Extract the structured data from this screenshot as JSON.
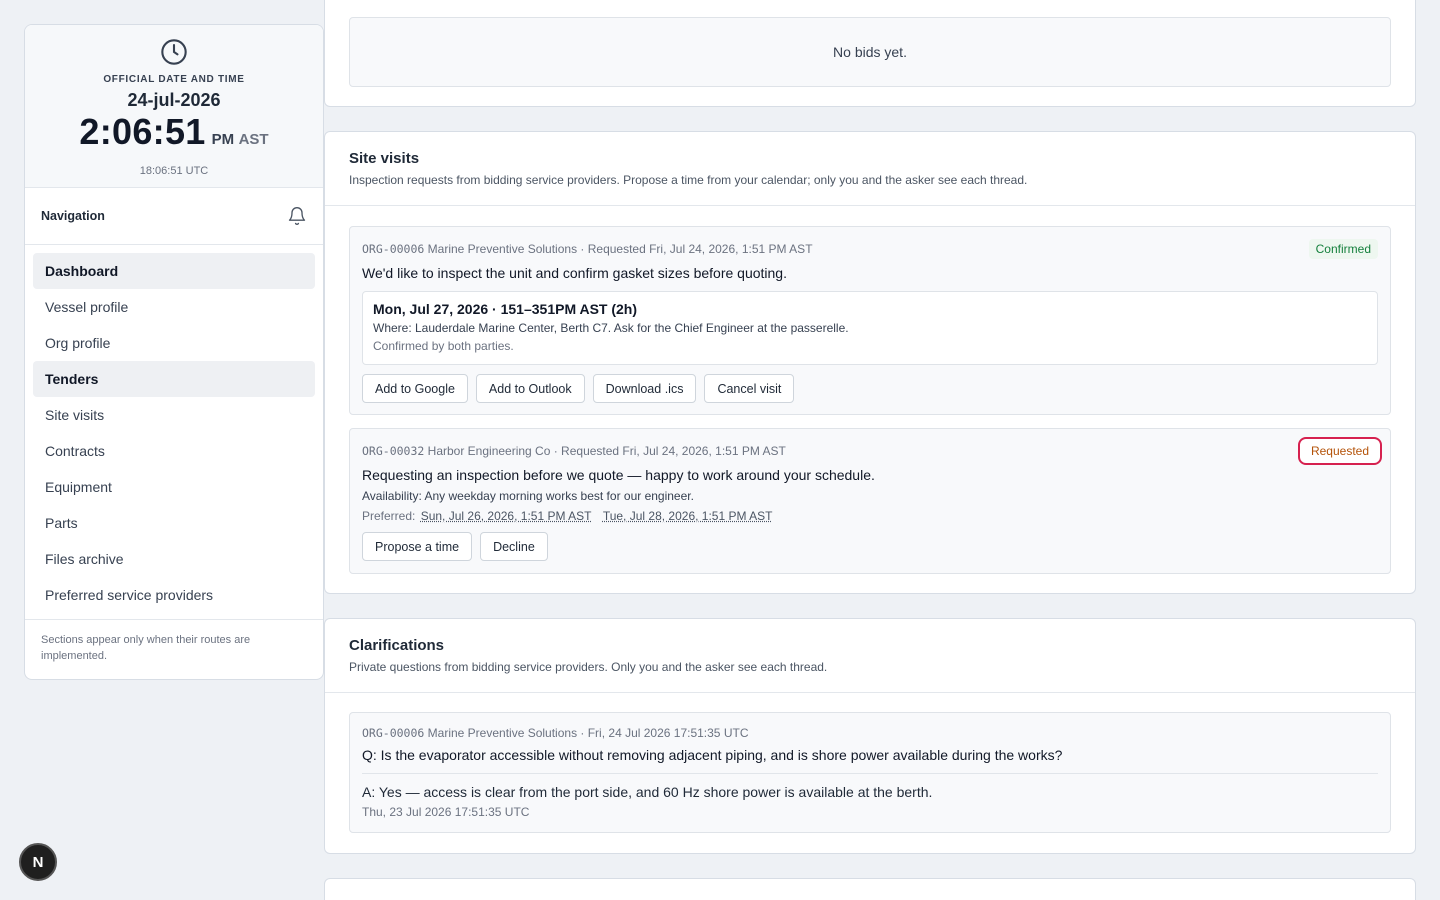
{
  "clock": {
    "title": "OFFICIAL DATE AND TIME",
    "date": "24-jul-2026",
    "time": "2:06:51",
    "ampm": "PM",
    "tz": "AST",
    "utc": "18:06:51 UTC"
  },
  "nav": {
    "title": "Navigation",
    "items": [
      {
        "label": "Dashboard",
        "active": true
      },
      {
        "label": "Vessel profile",
        "active": false
      },
      {
        "label": "Org profile",
        "active": false
      },
      {
        "label": "Tenders",
        "active": true
      },
      {
        "label": "Site visits",
        "active": false
      },
      {
        "label": "Contracts",
        "active": false
      },
      {
        "label": "Equipment",
        "active": false
      },
      {
        "label": "Parts",
        "active": false
      },
      {
        "label": "Files archive",
        "active": false
      },
      {
        "label": "Preferred service providers",
        "active": false
      }
    ],
    "note": "Sections appear only when their routes are implemented."
  },
  "bids": {
    "empty": "No bids yet."
  },
  "site_visits": {
    "title": "Site visits",
    "subtitle": "Inspection requests from bidding service providers. Propose a time from your calendar; only you and the asker see each thread.",
    "visits": [
      {
        "org_id": "ORG-00006",
        "meta": "Marine Preventive Solutions · Requested Fri, Jul 24, 2026, 1:51 PM AST",
        "status": "Confirmed",
        "message": "We'd like to inspect the unit and confirm gasket sizes before quoting.",
        "slot_title": "Mon, Jul 27, 2026 · 151–351PM AST (2h)",
        "slot_where": "Where: Lauderdale Marine Center, Berth C7. Ask for the Chief Engineer at the passerelle.",
        "slot_confirmed": "Confirmed by both parties.",
        "buttons": [
          "Add to Google",
          "Add to Outlook",
          "Download .ics",
          "Cancel visit"
        ]
      },
      {
        "org_id": "ORG-00032",
        "meta": "Harbor Engineering Co · Requested Fri, Jul 24, 2026, 1:51 PM AST",
        "status": "Requested",
        "message": "Requesting an inspection before we quote — happy to work around your schedule.",
        "availability": "Availability: Any weekday morning works best for our engineer.",
        "preferred_label": "Preferred:",
        "preferred": [
          "Sun, Jul 26, 2026, 1:51 PM AST",
          "Tue, Jul 28, 2026, 1:51 PM AST"
        ],
        "buttons": [
          "Propose a time",
          "Decline"
        ]
      }
    ]
  },
  "clarifications": {
    "title": "Clarifications",
    "subtitle": "Private questions from bidding service providers. Only you and the asker see each thread.",
    "items": [
      {
        "org_id": "ORG-00006",
        "meta": "Marine Preventive Solutions · Fri, 24 Jul 2026 17:51:35 UTC",
        "question": "Q: Is the evaporator accessible without removing adjacent piping, and is shore power available during the works?",
        "answer": "A: Yes — access is clear from the port side, and 60 Hz shore power is available at the berth.",
        "answer_date": "Thu, 23 Jul 2026 17:51:35 UTC"
      }
    ]
  },
  "dev_badge": "N"
}
